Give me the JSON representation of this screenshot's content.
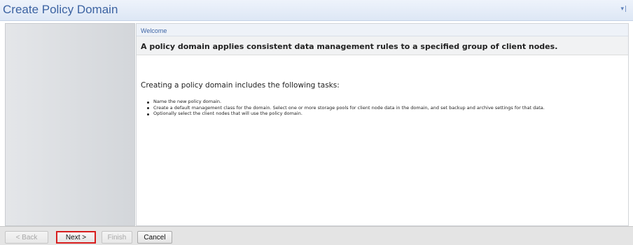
{
  "window": {
    "title": "Create Policy Domain",
    "controls": "▾|"
  },
  "main": {
    "step_name": "Welcome",
    "headline": "A policy domain applies consistent data management rules to a specified group of client nodes.",
    "intro": "Creating a policy domain includes the following tasks:",
    "tasks": [
      "Name the new policy domain.",
      "Create a default management class for the domain. Select one or more storage pools for client node data in the domain, and set backup and archive settings for that data.",
      "Optionally select the client nodes that will use the policy domain."
    ]
  },
  "footer": {
    "back_label": "< Back",
    "next_label": "Next >",
    "finish_label": "Finish",
    "cancel_label": "Cancel"
  },
  "colors": {
    "title": "#3c63a2",
    "highlight_border": "#d81e1e",
    "disabled_text": "#a8a8a8"
  }
}
